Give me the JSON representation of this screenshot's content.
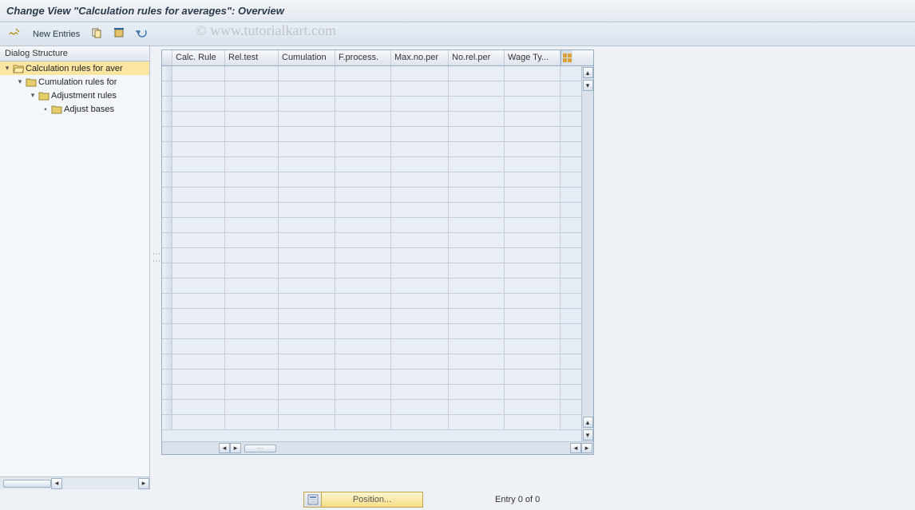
{
  "title": "Change View \"Calculation rules for averages\": Overview",
  "toolbar": {
    "new_entries": "New Entries"
  },
  "watermark": "© www.tutorialkart.com",
  "sidebar": {
    "header": "Dialog Structure",
    "tree": [
      {
        "label": "Calculation rules for aver",
        "indent": 0,
        "expanded": true,
        "open": true,
        "selected": true
      },
      {
        "label": "Cumulation rules for",
        "indent": 1,
        "expanded": true,
        "open": false,
        "selected": false
      },
      {
        "label": "Adjustment rules",
        "indent": 2,
        "expanded": true,
        "open": false,
        "selected": false
      },
      {
        "label": "Adjust bases",
        "indent": 3,
        "expanded": false,
        "open": false,
        "selected": false
      }
    ]
  },
  "table": {
    "columns": [
      {
        "label": "Calc. Rule",
        "width": 66
      },
      {
        "label": "Rel.test",
        "width": 67
      },
      {
        "label": "Cumulation",
        "width": 71
      },
      {
        "label": "F.process.",
        "width": 70
      },
      {
        "label": "Max.no.per",
        "width": 72
      },
      {
        "label": "No.rel.per",
        "width": 70
      },
      {
        "label": "Wage Ty...",
        "width": 70
      }
    ],
    "rows": 24
  },
  "footer": {
    "position_label": "Position...",
    "entry_text": "Entry 0 of 0"
  }
}
